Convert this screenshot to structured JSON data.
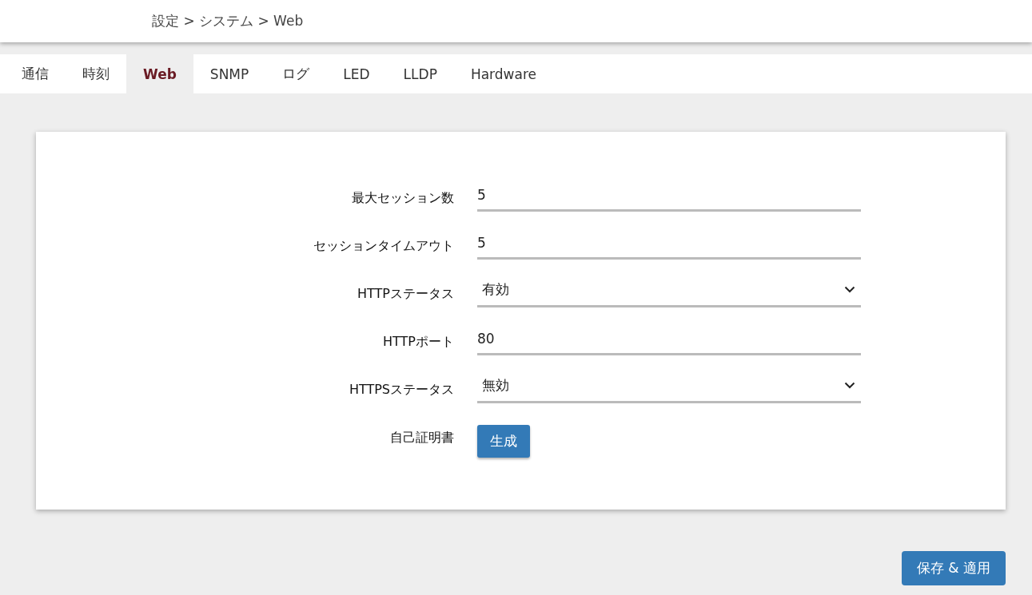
{
  "breadcrumb": "設定 > システム > Web",
  "tabs": [
    {
      "label": "通信",
      "selected": false
    },
    {
      "label": "時刻",
      "selected": false
    },
    {
      "label": "Web",
      "selected": true
    },
    {
      "label": "SNMP",
      "selected": false
    },
    {
      "label": "ログ",
      "selected": false
    },
    {
      "label": "LED",
      "selected": false
    },
    {
      "label": "LLDP",
      "selected": false
    },
    {
      "label": "Hardware",
      "selected": false
    }
  ],
  "form": [
    {
      "label": "最大セッション数",
      "kind": "text",
      "value": "5"
    },
    {
      "label": "セッションタイムアウト",
      "kind": "text",
      "value": "5"
    },
    {
      "label": "HTTPステータス",
      "kind": "select",
      "value": "有効"
    },
    {
      "label": "HTTPポート",
      "kind": "text",
      "value": "80"
    },
    {
      "label": "HTTPSステータス",
      "kind": "select",
      "value": "無効"
    },
    {
      "label": "自己証明書",
      "kind": "button",
      "value": "生成"
    }
  ],
  "save_button": "保存 & 適用"
}
